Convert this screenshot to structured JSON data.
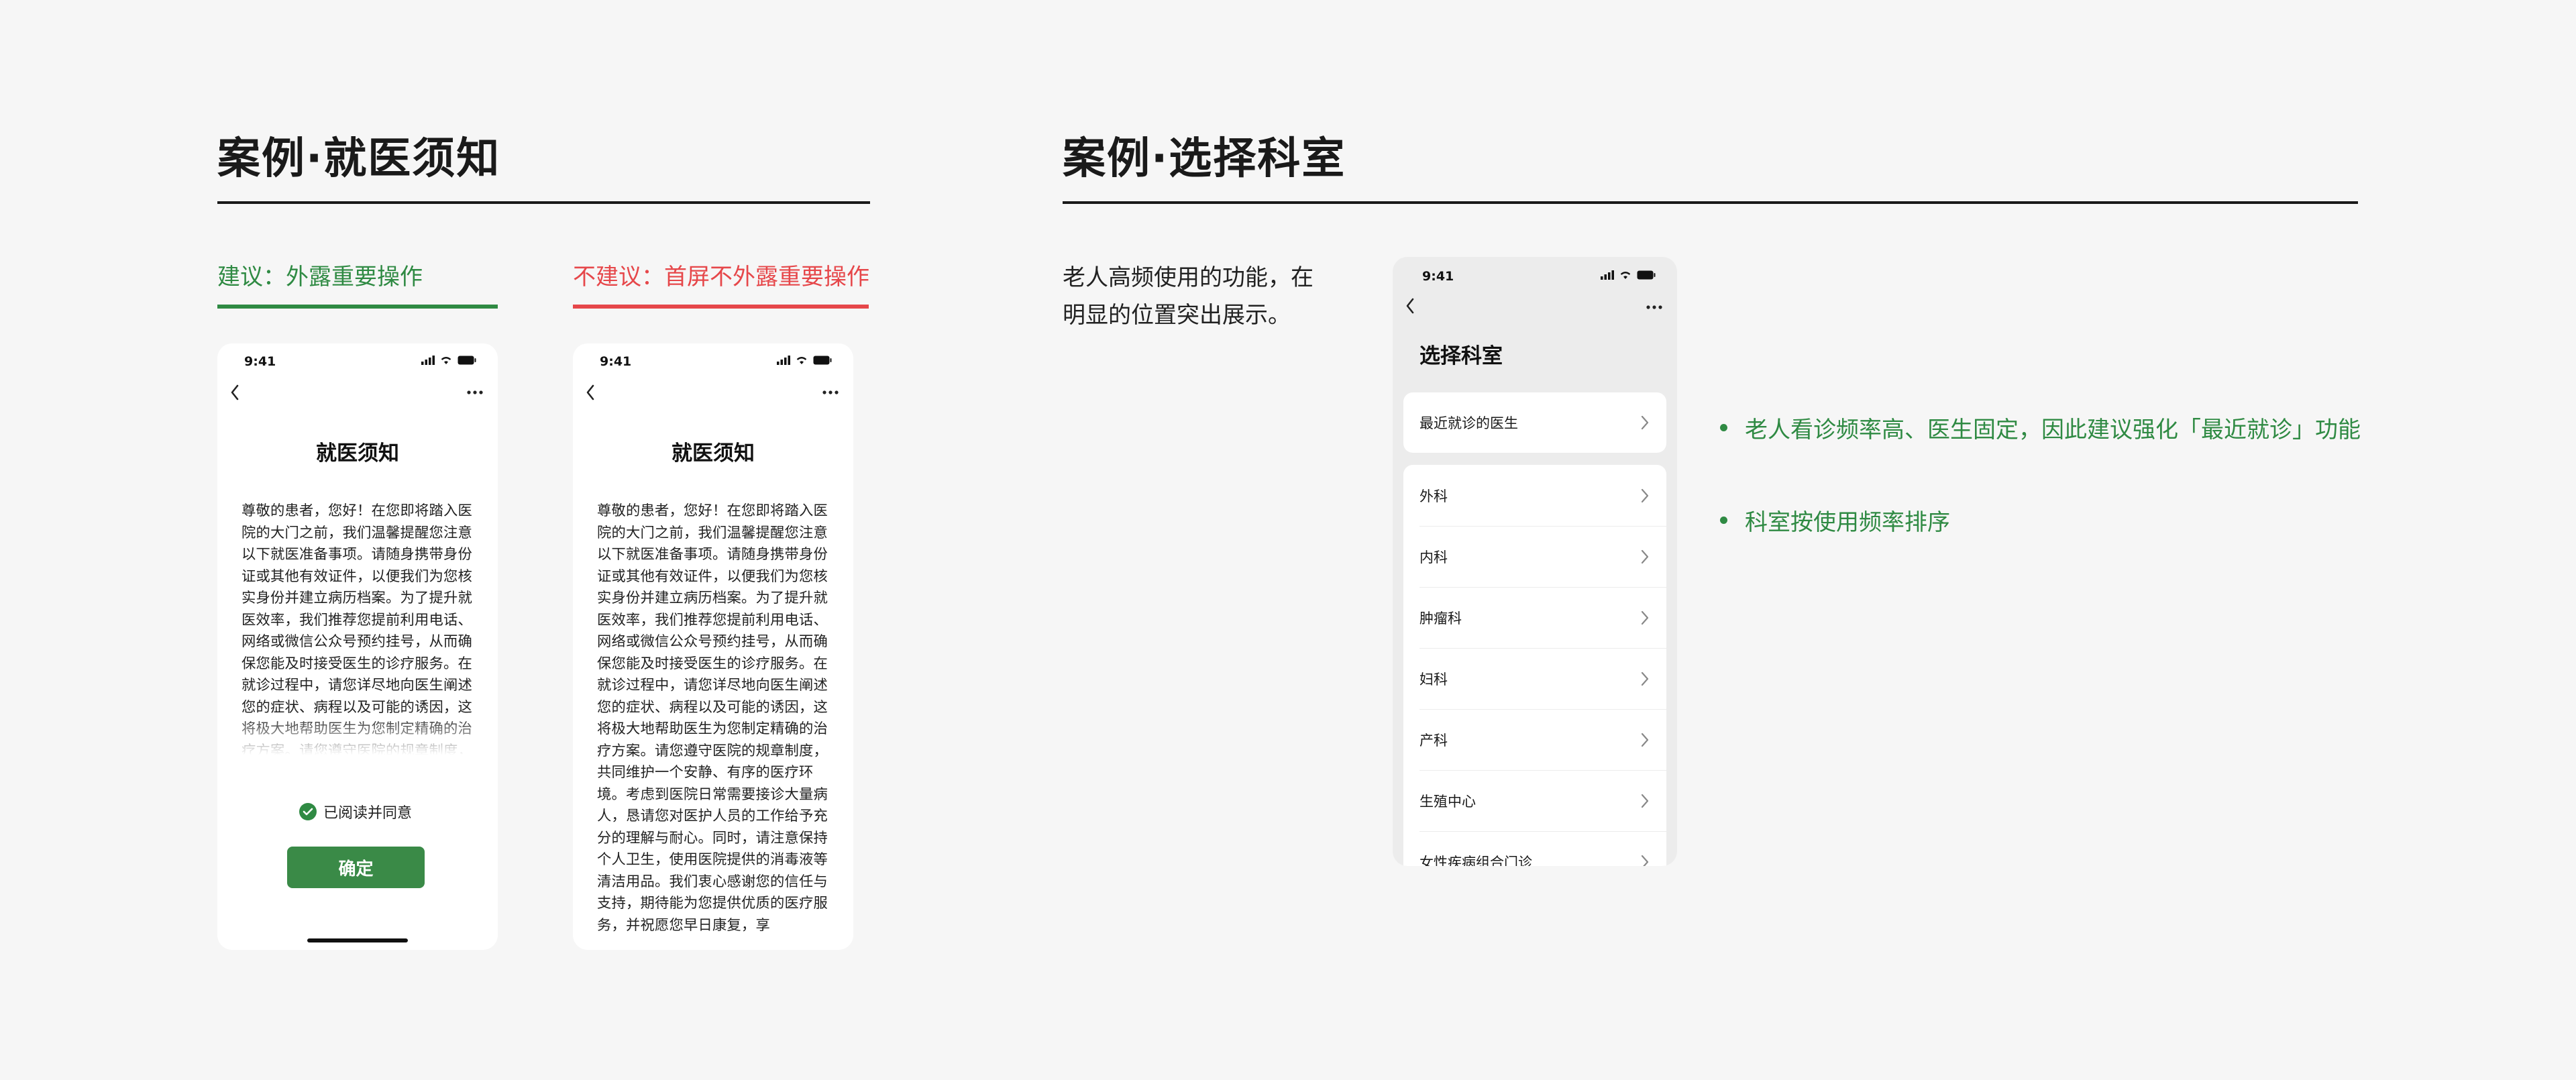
{
  "left_section": {
    "title": "案例·就医须知",
    "recommended_label": "建议：外露重要操作",
    "not_recommended_label": "不建议：首屏不外露重要操作"
  },
  "phone_good": {
    "time": "9:41",
    "heading": "就医须知",
    "body": "尊敬的患者，您好！在您即将踏入医院的大门之前，我们温馨提醒您注意以下就医准备事项。请随身携带身份证或其他有效证件，以便我们为您核实身份并建立病历档案。为了提升就医效率，我们推荐您提前利用电话、网络或微信公众号预约挂号，从而确保您能及时接受医生的诊疗服务。在就诊过程中，请您详尽地向医生阐述您的症状、病程以及可能的诱因，这将极大地帮助医生为您制定精确的治疗方案。请您遵守医院的规章制度，共同维",
    "agree_label": "已阅读并同意",
    "confirm_label": "确定"
  },
  "phone_bad": {
    "time": "9:41",
    "heading": "就医须知",
    "body": "尊敬的患者，您好！在您即将踏入医院的大门之前，我们温馨提醒您注意以下就医准备事项。请随身携带身份证或其他有效证件，以便我们为您核实身份并建立病历档案。为了提升就医效率，我们推荐您提前利用电话、网络或微信公众号预约挂号，从而确保您能及时接受医生的诊疗服务。在就诊过程中，请您详尽地向医生阐述您的症状、病程以及可能的诱因，这将极大地帮助医生为您制定精确的治疗方案。请您遵守医院的规章制度，共同维护一个安静、有序的医疗环境。考虑到医院日常需要接诊大量病人，恳请您对医护人员的工作给予充分的理解与耐心。同时，请注意保持个人卫生，使用医院提供的消毒液等清洁用品。我们衷心感谢您的信任与支持，期待能为您提供优质的医疗服务，并祝愿您早日康复，享"
  },
  "right_section": {
    "title": "案例·选择科室",
    "description_line1": "老人高频使用的功能，在",
    "description_line2": "明显的位置突出展示。"
  },
  "phone_dept": {
    "time": "9:41",
    "heading": "选择科室",
    "recent_doctor": "最近就诊的医生",
    "departments": [
      "外科",
      "内科",
      "肿瘤科",
      "妇科",
      "产科",
      "生殖中心",
      "女性疾病组合门诊"
    ]
  },
  "notes": [
    "老人看诊频率高、医生固定，因此建议强化「最近就诊」功能",
    "科室按使用频率排序"
  ],
  "colors": {
    "good": "#2f8a43",
    "bad": "#e6474a",
    "background": "#f6f6f6"
  }
}
